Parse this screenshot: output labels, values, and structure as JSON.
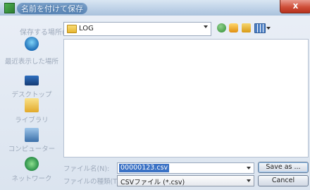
{
  "window": {
    "title": "名前を付けて保存",
    "close_label": "x"
  },
  "savein": {
    "label": "保存する場所(I):",
    "value": "LOG"
  },
  "places": [
    {
      "id": "recent",
      "label": "最近表示した場所",
      "icon": "recent-places-icon"
    },
    {
      "id": "desktop",
      "label": "デスクトップ",
      "icon": "desktop-icon"
    },
    {
      "id": "libraries",
      "label": "ライブラリ",
      "icon": "libraries-icon"
    },
    {
      "id": "computer",
      "label": "コンピューター",
      "icon": "computer-icon"
    },
    {
      "id": "network",
      "label": "ネットワーク",
      "icon": "network-icon"
    }
  ],
  "filename": {
    "label": "ファイル名(N):",
    "value": "00000123.csv"
  },
  "filetype": {
    "label": "ファイルの種類(T):",
    "value": "CSVファイル (*.csv)"
  },
  "buttons": {
    "save": "Save as ...",
    "cancel": "Cancel"
  },
  "colors": {
    "accent": "#3b72c5",
    "close": "#cf4f3a"
  }
}
